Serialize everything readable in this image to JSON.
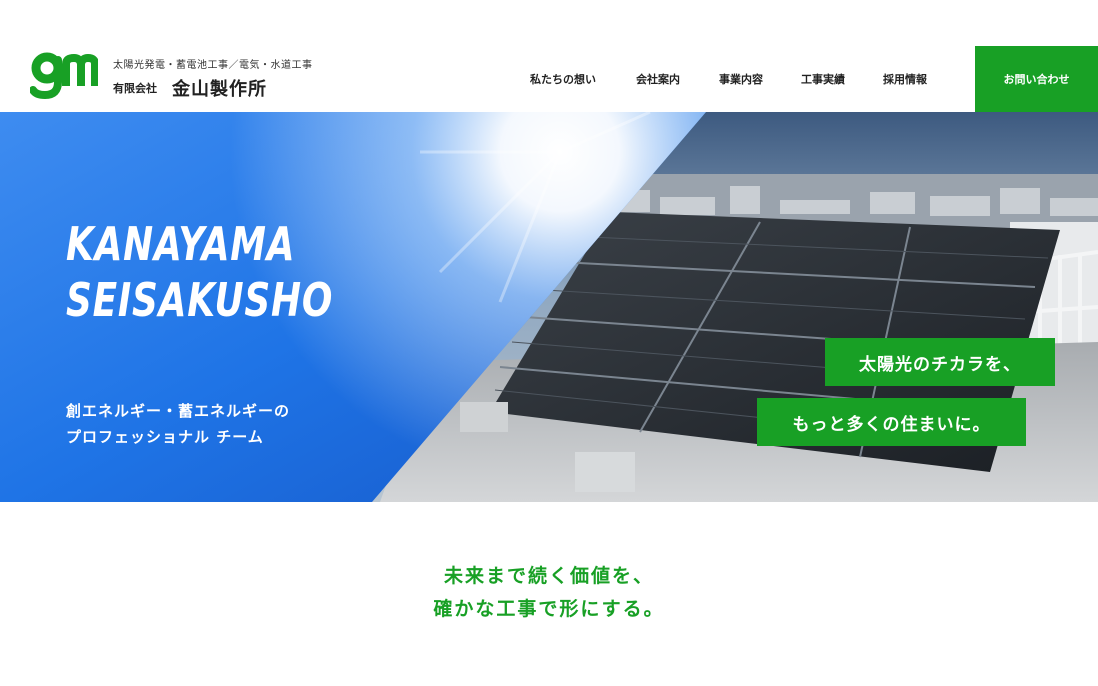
{
  "header": {
    "logo_text": "gm",
    "tagline": "太陽光発電・蓄電池工事／電気・水道工事",
    "company_type": "有限会社",
    "company_name": "金山製作所",
    "nav": [
      {
        "label": "私たちの想い"
      },
      {
        "label": "会社案内"
      },
      {
        "label": "事業内容"
      },
      {
        "label": "工事実績"
      },
      {
        "label": "採用情報"
      }
    ],
    "contact_label": "お問い合わせ"
  },
  "hero": {
    "title_line1": "KANAYAMA",
    "title_line2": "SEISAKUSHO",
    "sub_line1": "創エネルギー・蓄エネルギーの",
    "sub_line2": "プロフェッショナル チーム",
    "catch1": "太陽光のチカラを、",
    "catch2": "もっと多くの住まいに。"
  },
  "intro": {
    "line1": "未来まで続く価値を、",
    "line2": "確かな工事で形にする。"
  },
  "colors": {
    "brand_green": "#18a025",
    "hero_blue": "#1a6fe0"
  }
}
